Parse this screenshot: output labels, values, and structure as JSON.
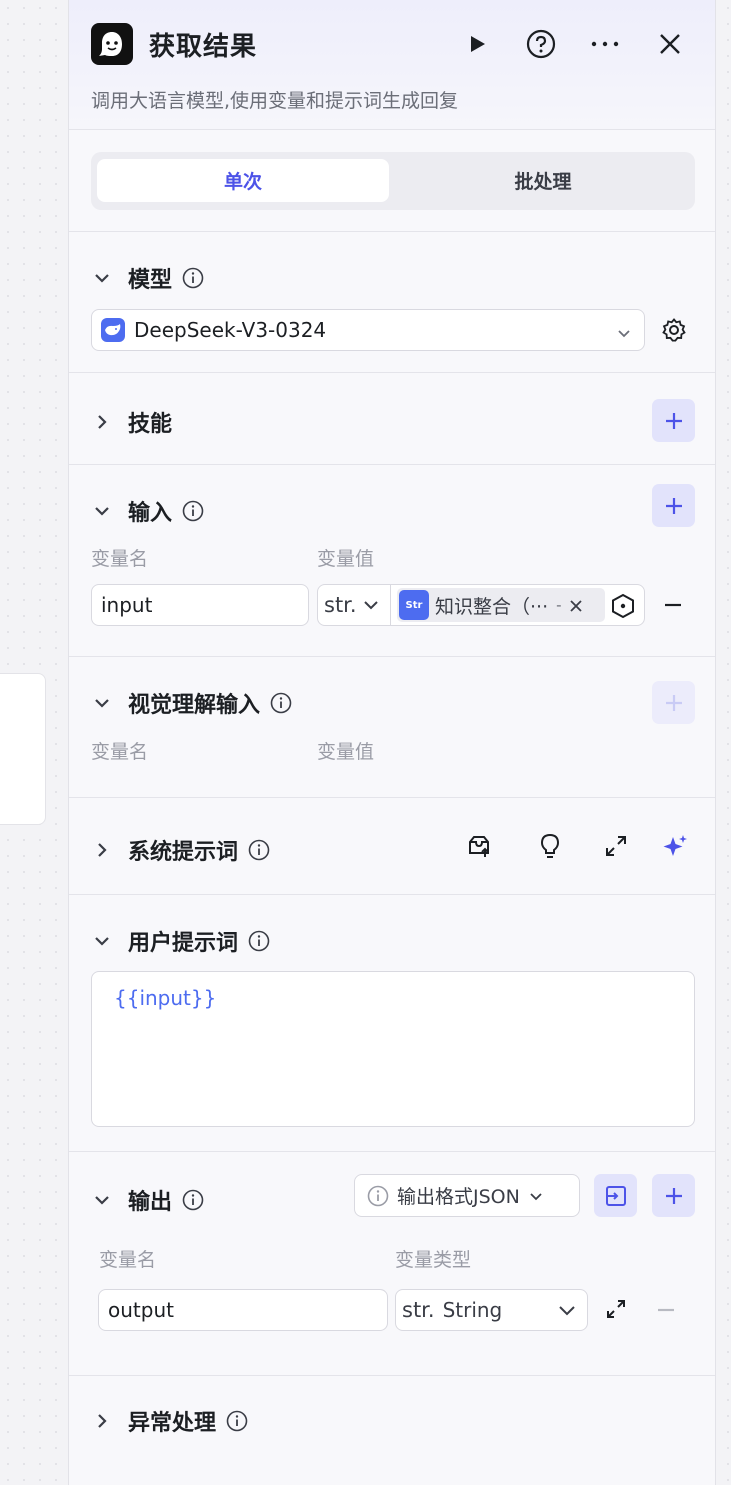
{
  "header": {
    "title": "获取结果",
    "subtitle": "调用大语言模型,使用变量和提示词生成回复"
  },
  "tabs": [
    {
      "label": "单次",
      "active": true
    },
    {
      "label": "批处理",
      "active": false
    }
  ],
  "model_section": {
    "title": "模型",
    "selected_model": "DeepSeek-V3-0324"
  },
  "skills_section": {
    "title": "技能"
  },
  "input_section": {
    "title": "输入",
    "col_name": "变量名",
    "col_value": "变量值",
    "row": {
      "name": "input",
      "type_short": "str.",
      "ref_icon": "Str",
      "ref_label": "知识整合（···",
      "ref_suffix": "-"
    }
  },
  "vision_section": {
    "title": "视觉理解输入",
    "col_name": "变量名",
    "col_value": "变量值"
  },
  "system_prompt_section": {
    "title": "系统提示词"
  },
  "user_prompt_section": {
    "title": "用户提示词",
    "content": "{{input}}"
  },
  "output_section": {
    "title": "输出",
    "format_label": "输出格式JSON",
    "col_name": "变量名",
    "col_type": "变量类型",
    "row": {
      "name": "output",
      "type_short": "str.",
      "type_label": "String"
    }
  },
  "error_section": {
    "title": "异常处理"
  },
  "colors": {
    "accent": "#4d53e8",
    "accent_light": "#e2e3fb",
    "ref_icon_bg": "#4d6cf0",
    "panel_bg": "#f8f8fb"
  },
  "icons": [
    "bot-logo-icon",
    "play-icon",
    "help-icon",
    "more-icon",
    "close-icon",
    "chevron-icon",
    "info-icon",
    "deepseek-icon",
    "settings-icon",
    "plus-icon",
    "minus-icon",
    "variable-ref-icon",
    "prompt-library-icon",
    "bulb-icon",
    "expand-icon",
    "sparkle-icon",
    "output-format-icon"
  ]
}
